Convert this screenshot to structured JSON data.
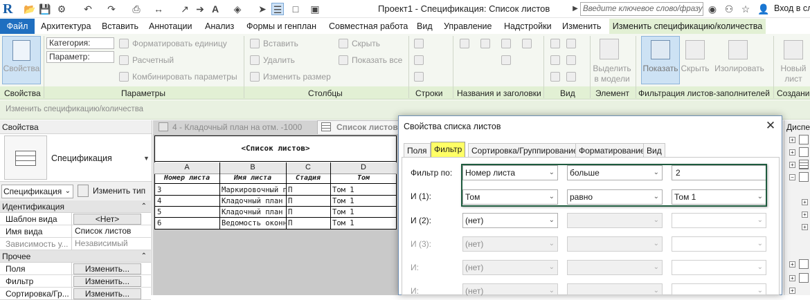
{
  "app": {
    "title": "Проект1 - Спецификация: Список листов",
    "logo": "R",
    "search_placeholder": "Введите ключевое слово/фразу",
    "signin": "Вход в слу"
  },
  "menu": {
    "file": "Файл",
    "tabs": [
      "Архитектура",
      "Вставить",
      "Аннотации",
      "Анализ",
      "Формы и генплан",
      "Совместная работа",
      "Вид",
      "Управление",
      "Надстройки",
      "Изменить"
    ],
    "active_tab": "Изменить спецификацию/количества"
  },
  "ribbon": {
    "properties_btn": "Свойства",
    "category_label": "Категория:",
    "parameter_label": "Параметр:",
    "format_unit": "Форматировать единицу",
    "calculated": "Расчетный",
    "combine": "Комбинировать параметры",
    "insert": "Вставить",
    "delete": "Удалить",
    "resize": "Изменить размер",
    "hide": "Скрыть",
    "show_all": "Показать все",
    "highlight_model_1": "Выделить",
    "highlight_model_2": "в модели",
    "show": "Показать",
    "hide2": "Скрыть",
    "isolate": "Изолировать",
    "new_1": "Новый",
    "new_2": "лист",
    "group_labels": [
      "Свойства",
      "Параметры",
      "Столбцы",
      "Строки",
      "Названия и заголовки",
      "Вид",
      "Элемент",
      "Фильтрация листов-заполнителей",
      "Создание"
    ]
  },
  "infobar": "Изменить спецификацию/количества",
  "properties": {
    "header": "Свойства",
    "type_name": "Спецификация",
    "selector": "Спецификация",
    "edit_type": "Изменить тип",
    "sections": {
      "identification": "Идентификация",
      "other": "Прочее"
    },
    "rows": [
      {
        "name": "Шаблон вида",
        "value": "<Нет>"
      },
      {
        "name": "Имя вида",
        "value": "Список листов"
      },
      {
        "name": "Зависимость у...",
        "value": "Независимый"
      }
    ],
    "other_rows": [
      {
        "name": "Поля",
        "value": "Изменить..."
      },
      {
        "name": "Фильтр",
        "value": "Изменить..."
      },
      {
        "name": "Сортировка/Гр...",
        "value": "Изменить..."
      }
    ]
  },
  "views": {
    "tab1": "4 - Кладочный план на отм. -1000",
    "tab2": "Список листов"
  },
  "schedule": {
    "title": "<Список листов>",
    "letters": [
      "A",
      "B",
      "C",
      "D"
    ],
    "headers": [
      "Номер листа",
      "Имя листа",
      "Стадия",
      "Том"
    ],
    "rows": [
      [
        "3",
        "Маркировочный п",
        "П",
        "Том 1"
      ],
      [
        "4",
        "Кладочный план н",
        "П",
        "Том 1"
      ],
      [
        "5",
        "Кладочный план н",
        "П",
        "Том 1"
      ],
      [
        "6",
        "Ведомость оконн",
        "П",
        "Том 1"
      ]
    ]
  },
  "dialog": {
    "title": "Свойства списка листов",
    "tabs": [
      "Поля",
      "Фильтр",
      "Сортировка/Группирование",
      "Форматирование",
      "Вид"
    ],
    "active_tab": "Фильтр",
    "filters": [
      {
        "label": "Фильтр по:",
        "field": "Номер листа",
        "op": "больше",
        "value": "2",
        "enabled": true
      },
      {
        "label": "И (1):",
        "field": "Том",
        "op": "равно",
        "value": "Том 1",
        "enabled": true
      },
      {
        "label": "И (2):",
        "field": "(нет)",
        "op": "",
        "value": "",
        "enabled": true
      },
      {
        "label": "И (3):",
        "field": "(нет)",
        "op": "",
        "value": "",
        "enabled": false
      },
      {
        "label": "И:",
        "field": "(нет)",
        "op": "",
        "value": "",
        "enabled": false
      },
      {
        "label": "И:",
        "field": "(нет)",
        "op": "",
        "value": "",
        "enabled": false
      }
    ]
  },
  "browser": {
    "header": "Диспе"
  },
  "colors": {
    "file_tab": "#1f6fc0",
    "ribbon_bg": "#e2f0d4",
    "highlight_box": "#1e5b3e",
    "active_dialog_tab": "#ffff66"
  }
}
